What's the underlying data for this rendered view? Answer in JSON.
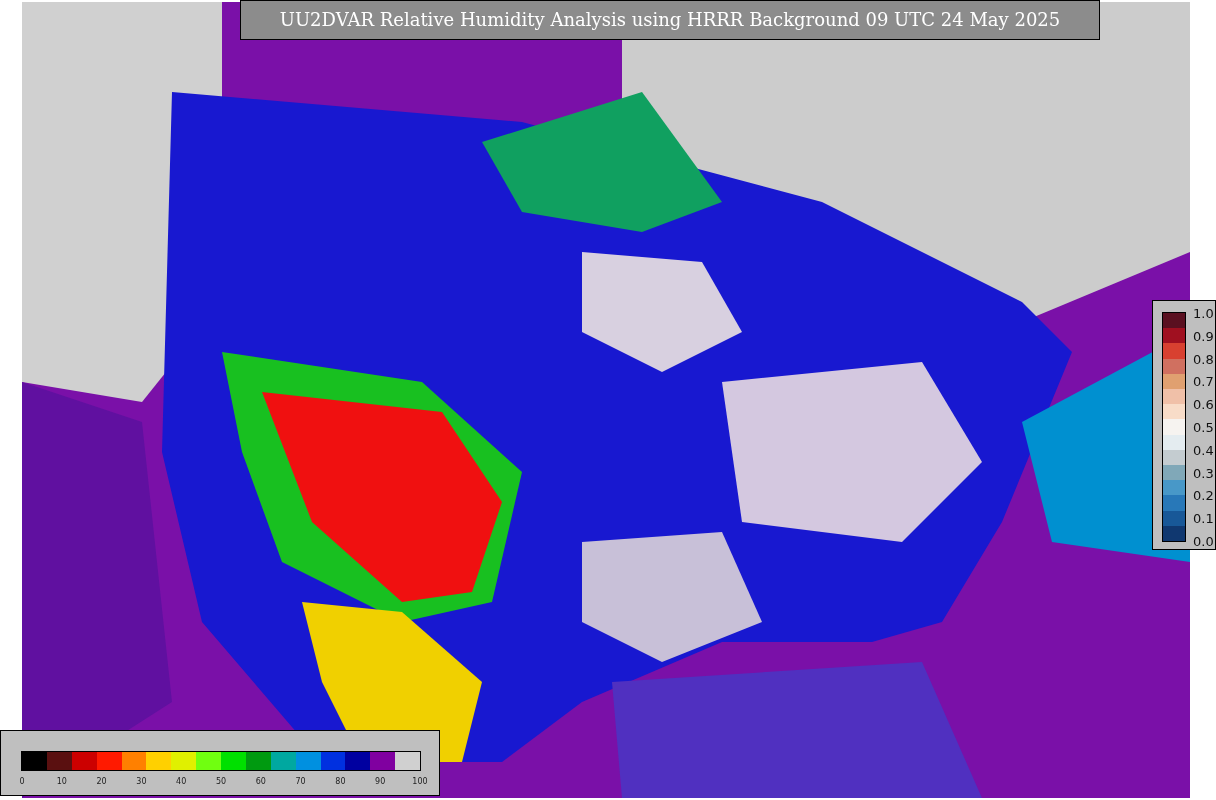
{
  "title": "UU2DVAR Relative Humidity Analysis using HRRR Background 09 UTC 24 May 2025",
  "humidity_colorbar": {
    "segments": [
      {
        "color": "#000000"
      },
      {
        "color": "#5a1010"
      },
      {
        "color": "#cc0000"
      },
      {
        "color": "#ff1a00"
      },
      {
        "color": "#ff8000"
      },
      {
        "color": "#ffd000"
      },
      {
        "color": "#e0f000"
      },
      {
        "color": "#70ff10"
      },
      {
        "color": "#00e000"
      },
      {
        "color": "#009a10"
      },
      {
        "color": "#00a8a0"
      },
      {
        "color": "#0090e0"
      },
      {
        "color": "#0030e0"
      },
      {
        "color": "#0000a0"
      },
      {
        "color": "#8000a0"
      },
      {
        "color": "#d0d0d0"
      }
    ],
    "ticks": [
      "0",
      "10",
      "20",
      "30",
      "40",
      "50",
      "60",
      "70",
      "80",
      "90",
      "100"
    ]
  },
  "value_colorbar": {
    "segments": [
      {
        "color": "#5a1020"
      },
      {
        "color": "#a01020"
      },
      {
        "color": "#d84030"
      },
      {
        "color": "#d07060"
      },
      {
        "color": "#e0a070"
      },
      {
        "color": "#f0c0a8"
      },
      {
        "color": "#f8dcc8"
      },
      {
        "color": "#f6f3f0"
      },
      {
        "color": "#e4ecf0"
      },
      {
        "color": "#c4ccd0"
      },
      {
        "color": "#80a8b8"
      },
      {
        "color": "#4898c8"
      },
      {
        "color": "#2878b8"
      },
      {
        "color": "#185898"
      },
      {
        "color": "#103870"
      }
    ],
    "ticks": [
      "1.0",
      "0.9",
      "0.8",
      "0.7",
      "0.6",
      "0.5",
      "0.4",
      "0.3",
      "0.2",
      "0.1",
      "0.0"
    ]
  }
}
